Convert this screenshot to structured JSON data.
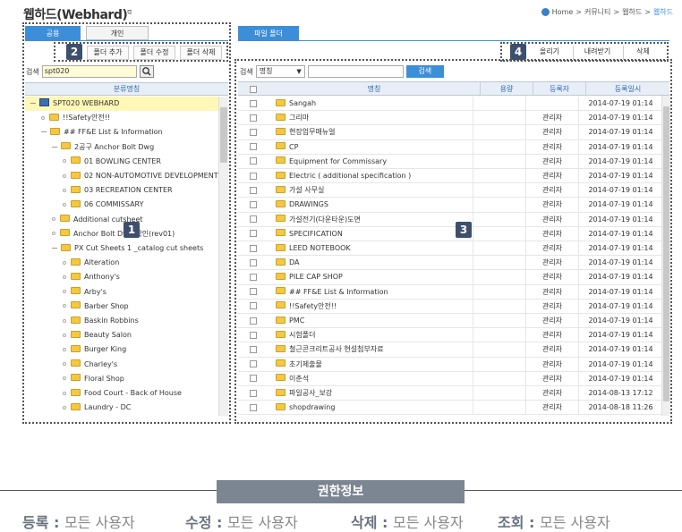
{
  "page": {
    "title": "웹하드(Webhard)",
    "title_sup": "⧉"
  },
  "breadcrumb": {
    "home": "Home",
    "sep": ">",
    "items": [
      "커뮤니티",
      "웹하드"
    ],
    "current": "웹하드"
  },
  "left_tabs": [
    "공용",
    "개인"
  ],
  "right_tab": "파일 폴더",
  "folder_buttons": [
    "폴더 추가",
    "폴더 수정",
    "폴더 삭제"
  ],
  "file_buttons": [
    "올리기",
    "내려받기",
    "삭제"
  ],
  "badges": [
    "1",
    "2",
    "3",
    "4"
  ],
  "left_search": {
    "label": "검색",
    "value": "spt020",
    "icon": "search-icon"
  },
  "tree_header": "분류명칭",
  "tree": [
    {
      "label": "SPT020 WEBHARD",
      "type": "root"
    },
    {
      "label": "!!Safety안전!!",
      "type": "leaf"
    },
    {
      "label": "## FF&E List & Information",
      "type": "open"
    },
    {
      "label": "2공구 Anchor Bolt Dwg",
      "type": "open"
    },
    {
      "label": "01 BOWLING CENTER",
      "type": "leaf"
    },
    {
      "label": "02 NON-AUTOMOTIVE DEVELOPMENT C",
      "type": "leaf"
    },
    {
      "label": "03 RECREATION CENTER",
      "type": "leaf"
    },
    {
      "label": "06 COMMISSARY",
      "type": "leaf"
    },
    {
      "label": "Additional cutsheet",
      "type": "leaf"
    },
    {
      "label": "Anchor Bolt Dwg 확인(rev01)",
      "type": "leaf"
    },
    {
      "label": "PX Cut Sheets 1 _catalog cut sheets",
      "type": "open"
    },
    {
      "label": "Alteration",
      "type": "leaf"
    },
    {
      "label": "Anthony's",
      "type": "leaf"
    },
    {
      "label": "Arby's",
      "type": "leaf"
    },
    {
      "label": "Barber Shop",
      "type": "leaf"
    },
    {
      "label": "Baskin Robbins",
      "type": "leaf"
    },
    {
      "label": "Beauty Salon",
      "type": "leaf"
    },
    {
      "label": "Burger King",
      "type": "leaf"
    },
    {
      "label": "Charley's",
      "type": "leaf"
    },
    {
      "label": "Floral Shop",
      "type": "leaf"
    },
    {
      "label": "Food Court - Back of House",
      "type": "leaf"
    },
    {
      "label": "Laundry - DC",
      "type": "leaf"
    }
  ],
  "right_search": {
    "label": "검색",
    "select": "명칭",
    "value": "",
    "button": "검색"
  },
  "grid_headers": [
    "명칭",
    "용량",
    "등록자",
    "등록일시"
  ],
  "grid_rows": [
    {
      "name": "Sangah",
      "size": "",
      "owner": "",
      "date": "2014-07-19 01:14"
    },
    {
      "name": "그리마",
      "size": "",
      "owner": "관리자",
      "date": "2014-07-19 01:14"
    },
    {
      "name": "현장업무매뉴얼",
      "size": "",
      "owner": "관리자",
      "date": "2014-07-19 01:14"
    },
    {
      "name": "CP",
      "size": "",
      "owner": "관리자",
      "date": "2014-07-19 01:14"
    },
    {
      "name": "Equipment for Commissary",
      "size": "",
      "owner": "관리자",
      "date": "2014-07-19 01:14"
    },
    {
      "name": "Electric ( additional specification )",
      "size": "",
      "owner": "관리자",
      "date": "2014-07-19 01:14"
    },
    {
      "name": "가설 사무실",
      "size": "",
      "owner": "관리자",
      "date": "2014-07-19 01:14"
    },
    {
      "name": "DRAWINGS",
      "size": "",
      "owner": "관리자",
      "date": "2014-07-19 01:14"
    },
    {
      "name": "가설전기(다운타운)도면",
      "size": "",
      "owner": "관리자",
      "date": "2014-07-19 01:14"
    },
    {
      "name": "SPECIFICATION",
      "size": "",
      "owner": "관리자",
      "date": "2014-07-19 01:14"
    },
    {
      "name": "LEED NOTEBOOK",
      "size": "",
      "owner": "관리자",
      "date": "2014-07-19 01:14"
    },
    {
      "name": "DA",
      "size": "",
      "owner": "관리자",
      "date": "2014-07-19 01:14"
    },
    {
      "name": "PILE CAP SHOP",
      "size": "",
      "owner": "관리자",
      "date": "2014-07-19 01:14"
    },
    {
      "name": "## FF&E List & Information",
      "size": "",
      "owner": "관리자",
      "date": "2014-07-19 01:14"
    },
    {
      "name": "!!Safety안전!!",
      "size": "",
      "owner": "관리자",
      "date": "2014-07-19 01:14"
    },
    {
      "name": "PMC",
      "size": "",
      "owner": "관리자",
      "date": "2014-07-19 01:14"
    },
    {
      "name": "시험폴더",
      "size": "",
      "owner": "관리자",
      "date": "2014-07-19 01:14"
    },
    {
      "name": "철근콘크리트공사 현설첨부자료",
      "size": "",
      "owner": "관리자",
      "date": "2014-07-19 01:14"
    },
    {
      "name": "초기제출물",
      "size": "",
      "owner": "관리자",
      "date": "2014-07-19 01:14"
    },
    {
      "name": "이춘석",
      "size": "",
      "owner": "관리자",
      "date": "2014-07-19 01:14"
    },
    {
      "name": "파일공사_보강",
      "size": "",
      "owner": "관리자",
      "date": "2014-08-13 17:12"
    },
    {
      "name": "shopdrawing",
      "size": "",
      "owner": "관리자",
      "date": "2014-08-18 11:26"
    }
  ],
  "permission": {
    "title": "권한정보",
    "items": [
      {
        "label": "등록",
        "value": "모든 사용자"
      },
      {
        "label": "수정",
        "value": "모든 사용자"
      },
      {
        "label": "삭제",
        "value": "모든 사용자"
      },
      {
        "label": "조회",
        "value": "모든 사용자"
      }
    ]
  },
  "colors": {
    "accent": "#3d8ed8",
    "badge": "#3d4f6d",
    "folder": "#f5c842",
    "perm_box": "#7c8592"
  }
}
